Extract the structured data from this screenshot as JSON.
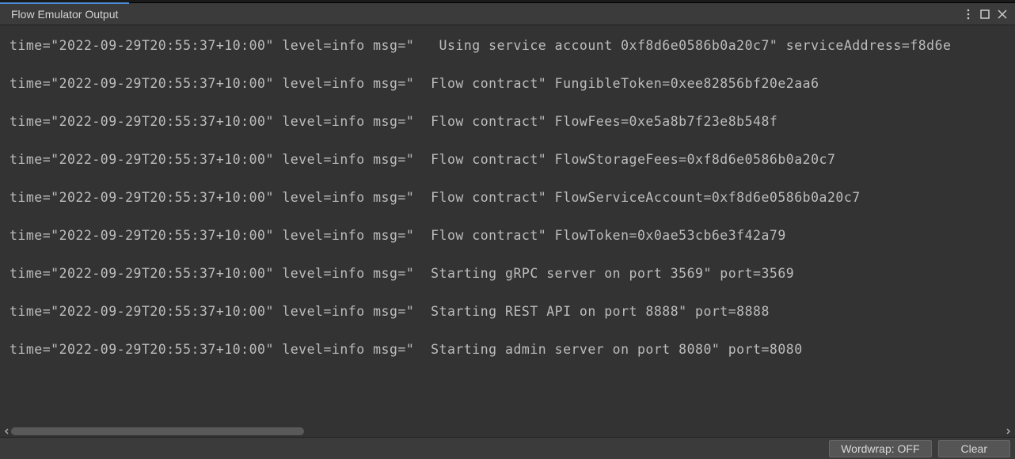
{
  "panel": {
    "title": "Flow Emulator Output"
  },
  "logs": [
    "time=\"2022-09-29T20:55:37+10:00\" level=info msg=\"   Using service account 0xf8d6e0586b0a20c7\" serviceAddress=f8d6e",
    "time=\"2022-09-29T20:55:37+10:00\" level=info msg=\"  Flow contract\" FungibleToken=0xee82856bf20e2aa6",
    "time=\"2022-09-29T20:55:37+10:00\" level=info msg=\"  Flow contract\" FlowFees=0xe5a8b7f23e8b548f",
    "time=\"2022-09-29T20:55:37+10:00\" level=info msg=\"  Flow contract\" FlowStorageFees=0xf8d6e0586b0a20c7",
    "time=\"2022-09-29T20:55:37+10:00\" level=info msg=\"  Flow contract\" FlowServiceAccount=0xf8d6e0586b0a20c7",
    "time=\"2022-09-29T20:55:37+10:00\" level=info msg=\"  Flow contract\" FlowToken=0x0ae53cb6e3f42a79",
    "time=\"2022-09-29T20:55:37+10:00\" level=info msg=\"  Starting gRPC server on port 3569\" port=3569",
    "time=\"2022-09-29T20:55:37+10:00\" level=info msg=\"  Starting REST API on port 8888\" port=8888",
    "time=\"2022-09-29T20:55:37+10:00\" level=info msg=\"  Starting admin server on port 8080\" port=8080"
  ],
  "footer": {
    "wordwrap_label": "Wordwrap: OFF",
    "clear_label": "Clear"
  }
}
